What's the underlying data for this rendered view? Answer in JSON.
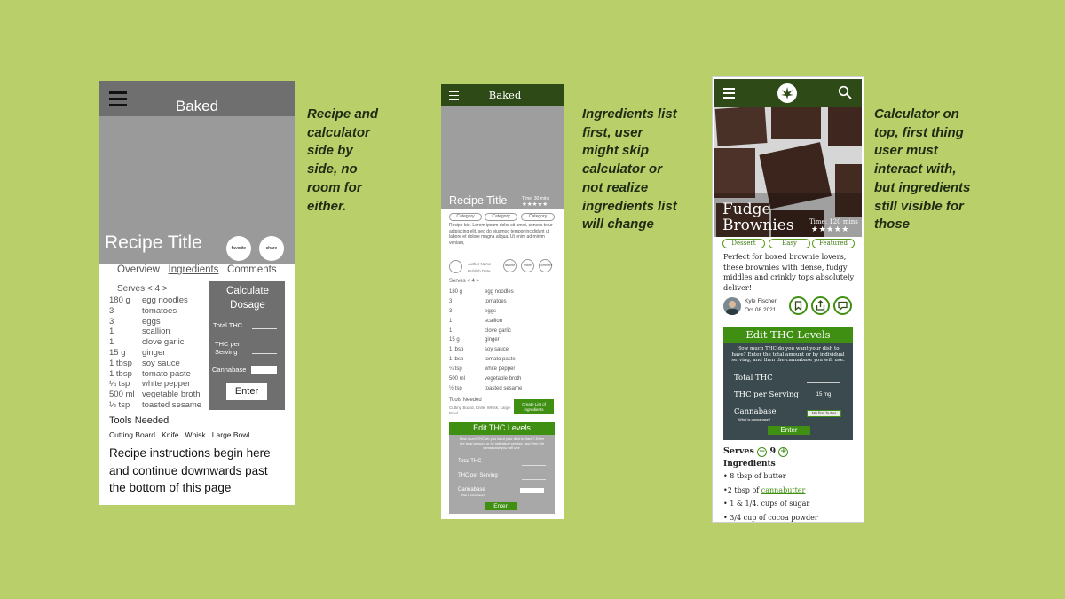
{
  "colors": {
    "background": "#b8cf6a",
    "green_dark": "#2e4b17",
    "green_accent": "#3f8f12",
    "gray_header": "#6f6f6f",
    "panel_dark": "#3a4a4e"
  },
  "phone1": {
    "title": "Baked",
    "recipe_title": "Recipe Title",
    "btn_favorite": "favorite",
    "btn_share": "share",
    "tabs": [
      "Overview",
      "Ingredients",
      "Comments"
    ],
    "serves": "Serves < 4 >",
    "ingredients": [
      [
        "180 g",
        "egg noodles"
      ],
      [
        "3",
        "tomatoes"
      ],
      [
        "3",
        "eggs"
      ],
      [
        "1",
        "scallion"
      ],
      [
        "1",
        "clove garlic"
      ],
      [
        "15 g",
        "ginger"
      ],
      [
        "1 tbsp",
        "soy sauce"
      ],
      [
        "1 tbsp",
        "tomato paste"
      ],
      [
        "¼ tsp",
        "white pepper"
      ],
      [
        "500 ml",
        "vegetable broth"
      ],
      [
        "½ tsp",
        "toasted sesame"
      ]
    ],
    "calc": {
      "title": "Calculate Dosage",
      "total_thc": "Total THC",
      "thc_per_serving": "THC per Serving",
      "cannabase": "Cannabase",
      "enter": "Enter"
    },
    "tools_title": "Tools Needed",
    "tools": [
      "Cutting Board",
      "Knife",
      "Whisk",
      "Large Bowl"
    ],
    "instructions": "Recipe instructions begin here and continue downwards past the bottom of this page"
  },
  "note1": "Recipe and\ncalculator\nside by\nside, no\nroom for\neither.",
  "phone2": {
    "title": "Baked",
    "recipe_title": "Recipe Title",
    "time": "Time: 30 mins",
    "stars": "★★★★★",
    "categories": [
      "Category",
      "Category",
      "Category"
    ],
    "description": "Recipe bio. Lorem ipsum dolor sit amet, consec tetur adipiscing elit, sed do eiusmod tempor incididunt ut labore et dolore magna aliqua. Ut enim ad minim veniam,",
    "author": "Author Name",
    "author_date": "Publish Date",
    "actions": [
      "favorite",
      "share",
      "comment"
    ],
    "serves": "Serves < 4 >",
    "ingredients": [
      [
        "180 g",
        "egg noodles"
      ],
      [
        "3",
        "tomatoes"
      ],
      [
        "3",
        "eggs"
      ],
      [
        "1",
        "scallion"
      ],
      [
        "1",
        "clove garlic"
      ],
      [
        "15 g",
        "ginger"
      ],
      [
        "1 tbsp",
        "soy sauce"
      ],
      [
        "1 tbsp",
        "tomato paste"
      ],
      [
        "¼ tsp",
        "white pepper"
      ],
      [
        "500 ml",
        "vegetable broth"
      ],
      [
        "½ tsp",
        "toasted sesame"
      ]
    ],
    "tools_title": "Tools Needed",
    "tools_list": "Cutting Board, Knife, Whisk, Large Bowl",
    "create_list": "Create List of ingredients",
    "edit_thc": "Edit THC Levels",
    "calc_desc": "How much THC do you want your dish to have? Enter the total amount or by individual serving, and then the cannabase you will use.",
    "total_thc": "Total THC",
    "thc_per_serving": "THC per Serving",
    "cannabase": "Cannabase",
    "cannabase_sub": "What is cannabase?",
    "enter": "Enter"
  },
  "note2": "Ingredients list\nfirst, user\nmight skip\ncalculator or\nnot realize\ningredients list\nwill change",
  "phone3": {
    "recipe_title": "Fudge Brownies",
    "time": "Time: 120 mins",
    "stars": "★★★★★",
    "categories": [
      "Dessert",
      "Easy",
      "Featured"
    ],
    "description": "Perfect for boxed brownie lovers, these brownies with dense, fudgy middles and crinkly tops absolutely deliver!",
    "author": "Kyle Fischer",
    "date": "Oct.08 2021",
    "edit_thc": "Edit THC Levels",
    "calc_desc": "How much THC do you want your dish to have? Enter the total amount or by individual serving, and then the cannabase you will use.",
    "total_thc": "Total THC",
    "thc_per_serving": "THC per Serving",
    "thc_value": "15 mg",
    "cannabase": "Cannabase",
    "cannabase_sub": "What is cannabase?",
    "cannabase_value": "My first butter",
    "enter": "Enter",
    "serves_label": "Serves",
    "serves_value": "9",
    "ingredients_title": "Ingredients",
    "ingredients": [
      "• 8 tbsp of butter",
      "•2 tbsp of",
      "• 1 & 1/4. cups of sugar",
      "• 3/4 cup of cocoa powder"
    ],
    "cannabutter_link": "cannabutter"
  },
  "note3": "Calculator on\ntop, first thing\nuser must\ninteract with,\nbut ingredients\nstill visible for\nthose"
}
